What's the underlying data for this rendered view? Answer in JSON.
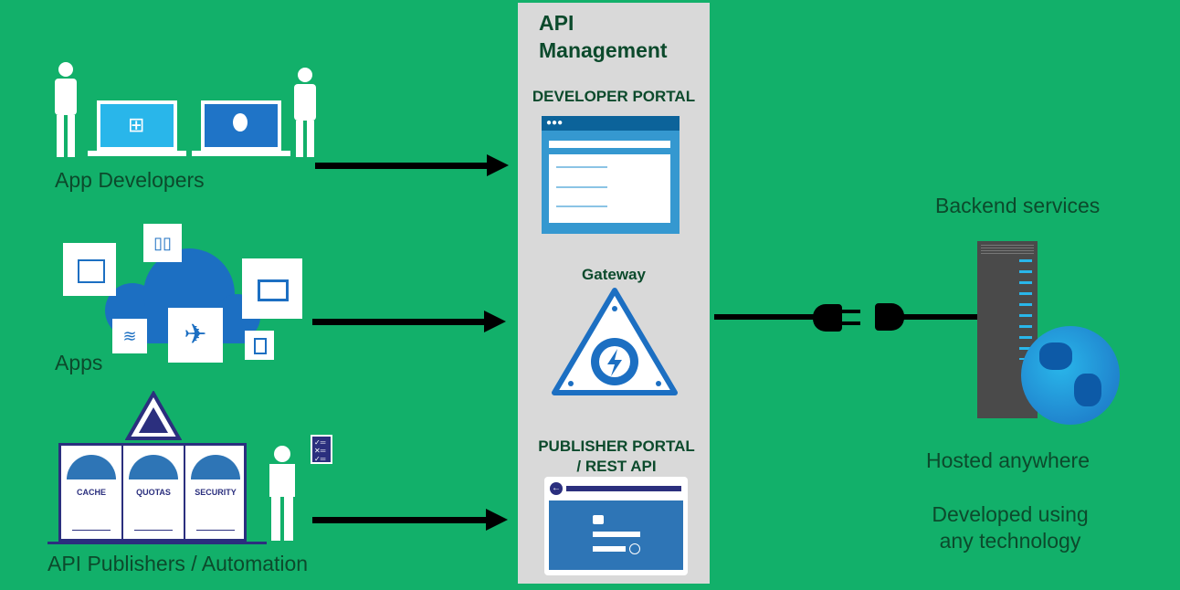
{
  "left": {
    "app_developers": "App Developers",
    "apps": "Apps",
    "publishers": "API Publishers / Automation",
    "gauges": [
      "CACHE",
      "QUOTAS",
      "SECURITY"
    ]
  },
  "center": {
    "title_line1": "API",
    "title_line2": "Management",
    "developer_portal": "DEVELOPER PORTAL",
    "gateway": "Gateway",
    "publisher_portal_line1": "PUBLISHER PORTAL",
    "publisher_portal_line2": "/ REST API"
  },
  "right": {
    "backend": "Backend services",
    "hosted": "Hosted anywhere",
    "developed_line1": "Developed using",
    "developed_line2": "any technology"
  },
  "colors": {
    "background": "#12b06a",
    "panel": "#d9d9d9",
    "text": "#0c4a2c",
    "icon_blue": "#2e75b6"
  }
}
